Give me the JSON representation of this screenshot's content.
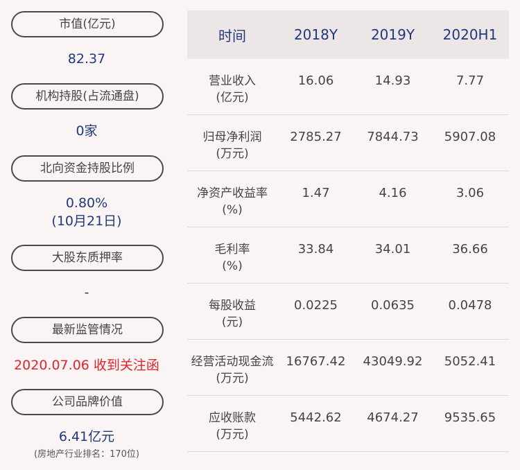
{
  "left": {
    "market_cap_label": "市值(亿元)",
    "market_cap_value": "82.37",
    "institutions_label": "机构持股(占流通盘)",
    "institutions_value": "0家",
    "northbound_label": "北向资金持股比例",
    "northbound_value": "0.80%",
    "northbound_date": "(10月21日)",
    "pledge_label": "大股东质押率",
    "pledge_value": "-",
    "regulation_label": "最新监管情况",
    "regulation_value": "2020.07.06 收到关注函",
    "brand_label": "公司品牌价值",
    "brand_value": "6.41亿元",
    "brand_note": "(房地产行业排名：170位)"
  },
  "table": {
    "headers": [
      "时间",
      "2018Y",
      "2019Y",
      "2020H1"
    ],
    "rows": [
      {
        "metric": "营业收入",
        "unit": "(亿元)",
        "values": [
          "16.06",
          "14.93",
          "7.77"
        ]
      },
      {
        "metric": "归母净利润",
        "unit": "(万元)",
        "values": [
          "2785.27",
          "7844.73",
          "5907.08"
        ]
      },
      {
        "metric": "净资产收益率",
        "unit": "(%)",
        "values": [
          "1.47",
          "4.16",
          "3.06"
        ]
      },
      {
        "metric": "毛利率",
        "unit": "(%)",
        "values": [
          "33.84",
          "34.01",
          "36.66"
        ]
      },
      {
        "metric": "每股收益",
        "unit": "(元)",
        "values": [
          "0.0225",
          "0.0635",
          "0.0478"
        ]
      },
      {
        "metric": "经营活动现金流",
        "unit": "(万元)",
        "values": [
          "16767.42",
          "43049.92",
          "5052.41"
        ]
      },
      {
        "metric": "应收账款",
        "unit": "(万元)",
        "values": [
          "5442.62",
          "4674.27",
          "9535.65"
        ]
      }
    ]
  }
}
